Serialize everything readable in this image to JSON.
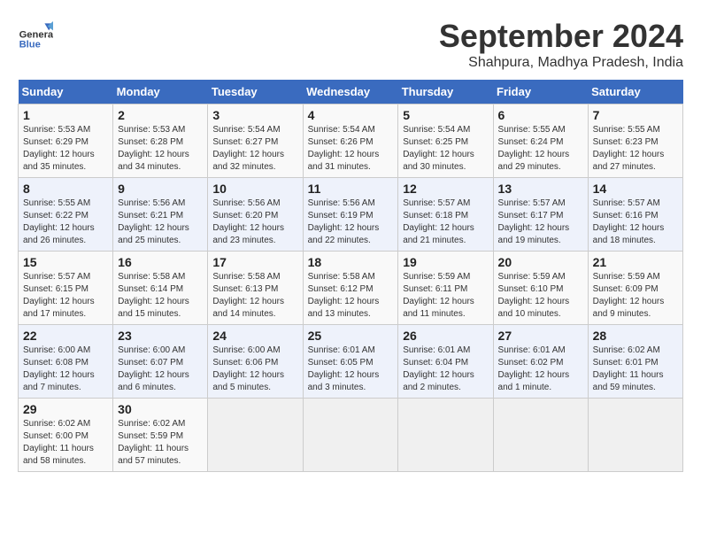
{
  "logo": {
    "line1": "General",
    "line2": "Blue"
  },
  "title": "September 2024",
  "subtitle": "Shahpura, Madhya Pradesh, India",
  "days_of_week": [
    "Sunday",
    "Monday",
    "Tuesday",
    "Wednesday",
    "Thursday",
    "Friday",
    "Saturday"
  ],
  "weeks": [
    [
      {
        "day": "1",
        "info": "Sunrise: 5:53 AM\nSunset: 6:29 PM\nDaylight: 12 hours\nand 35 minutes."
      },
      {
        "day": "2",
        "info": "Sunrise: 5:53 AM\nSunset: 6:28 PM\nDaylight: 12 hours\nand 34 minutes."
      },
      {
        "day": "3",
        "info": "Sunrise: 5:54 AM\nSunset: 6:27 PM\nDaylight: 12 hours\nand 32 minutes."
      },
      {
        "day": "4",
        "info": "Sunrise: 5:54 AM\nSunset: 6:26 PM\nDaylight: 12 hours\nand 31 minutes."
      },
      {
        "day": "5",
        "info": "Sunrise: 5:54 AM\nSunset: 6:25 PM\nDaylight: 12 hours\nand 30 minutes."
      },
      {
        "day": "6",
        "info": "Sunrise: 5:55 AM\nSunset: 6:24 PM\nDaylight: 12 hours\nand 29 minutes."
      },
      {
        "day": "7",
        "info": "Sunrise: 5:55 AM\nSunset: 6:23 PM\nDaylight: 12 hours\nand 27 minutes."
      }
    ],
    [
      {
        "day": "8",
        "info": "Sunrise: 5:55 AM\nSunset: 6:22 PM\nDaylight: 12 hours\nand 26 minutes."
      },
      {
        "day": "9",
        "info": "Sunrise: 5:56 AM\nSunset: 6:21 PM\nDaylight: 12 hours\nand 25 minutes."
      },
      {
        "day": "10",
        "info": "Sunrise: 5:56 AM\nSunset: 6:20 PM\nDaylight: 12 hours\nand 23 minutes."
      },
      {
        "day": "11",
        "info": "Sunrise: 5:56 AM\nSunset: 6:19 PM\nDaylight: 12 hours\nand 22 minutes."
      },
      {
        "day": "12",
        "info": "Sunrise: 5:57 AM\nSunset: 6:18 PM\nDaylight: 12 hours\nand 21 minutes."
      },
      {
        "day": "13",
        "info": "Sunrise: 5:57 AM\nSunset: 6:17 PM\nDaylight: 12 hours\nand 19 minutes."
      },
      {
        "day": "14",
        "info": "Sunrise: 5:57 AM\nSunset: 6:16 PM\nDaylight: 12 hours\nand 18 minutes."
      }
    ],
    [
      {
        "day": "15",
        "info": "Sunrise: 5:57 AM\nSunset: 6:15 PM\nDaylight: 12 hours\nand 17 minutes."
      },
      {
        "day": "16",
        "info": "Sunrise: 5:58 AM\nSunset: 6:14 PM\nDaylight: 12 hours\nand 15 minutes."
      },
      {
        "day": "17",
        "info": "Sunrise: 5:58 AM\nSunset: 6:13 PM\nDaylight: 12 hours\nand 14 minutes."
      },
      {
        "day": "18",
        "info": "Sunrise: 5:58 AM\nSunset: 6:12 PM\nDaylight: 12 hours\nand 13 minutes."
      },
      {
        "day": "19",
        "info": "Sunrise: 5:59 AM\nSunset: 6:11 PM\nDaylight: 12 hours\nand 11 minutes."
      },
      {
        "day": "20",
        "info": "Sunrise: 5:59 AM\nSunset: 6:10 PM\nDaylight: 12 hours\nand 10 minutes."
      },
      {
        "day": "21",
        "info": "Sunrise: 5:59 AM\nSunset: 6:09 PM\nDaylight: 12 hours\nand 9 minutes."
      }
    ],
    [
      {
        "day": "22",
        "info": "Sunrise: 6:00 AM\nSunset: 6:08 PM\nDaylight: 12 hours\nand 7 minutes."
      },
      {
        "day": "23",
        "info": "Sunrise: 6:00 AM\nSunset: 6:07 PM\nDaylight: 12 hours\nand 6 minutes."
      },
      {
        "day": "24",
        "info": "Sunrise: 6:00 AM\nSunset: 6:06 PM\nDaylight: 12 hours\nand 5 minutes."
      },
      {
        "day": "25",
        "info": "Sunrise: 6:01 AM\nSunset: 6:05 PM\nDaylight: 12 hours\nand 3 minutes."
      },
      {
        "day": "26",
        "info": "Sunrise: 6:01 AM\nSunset: 6:04 PM\nDaylight: 12 hours\nand 2 minutes."
      },
      {
        "day": "27",
        "info": "Sunrise: 6:01 AM\nSunset: 6:02 PM\nDaylight: 12 hours\nand 1 minute."
      },
      {
        "day": "28",
        "info": "Sunrise: 6:02 AM\nSunset: 6:01 PM\nDaylight: 11 hours\nand 59 minutes."
      }
    ],
    [
      {
        "day": "29",
        "info": "Sunrise: 6:02 AM\nSunset: 6:00 PM\nDaylight: 11 hours\nand 58 minutes."
      },
      {
        "day": "30",
        "info": "Sunrise: 6:02 AM\nSunset: 5:59 PM\nDaylight: 11 hours\nand 57 minutes."
      },
      {
        "day": "",
        "info": ""
      },
      {
        "day": "",
        "info": ""
      },
      {
        "day": "",
        "info": ""
      },
      {
        "day": "",
        "info": ""
      },
      {
        "day": "",
        "info": ""
      }
    ]
  ]
}
